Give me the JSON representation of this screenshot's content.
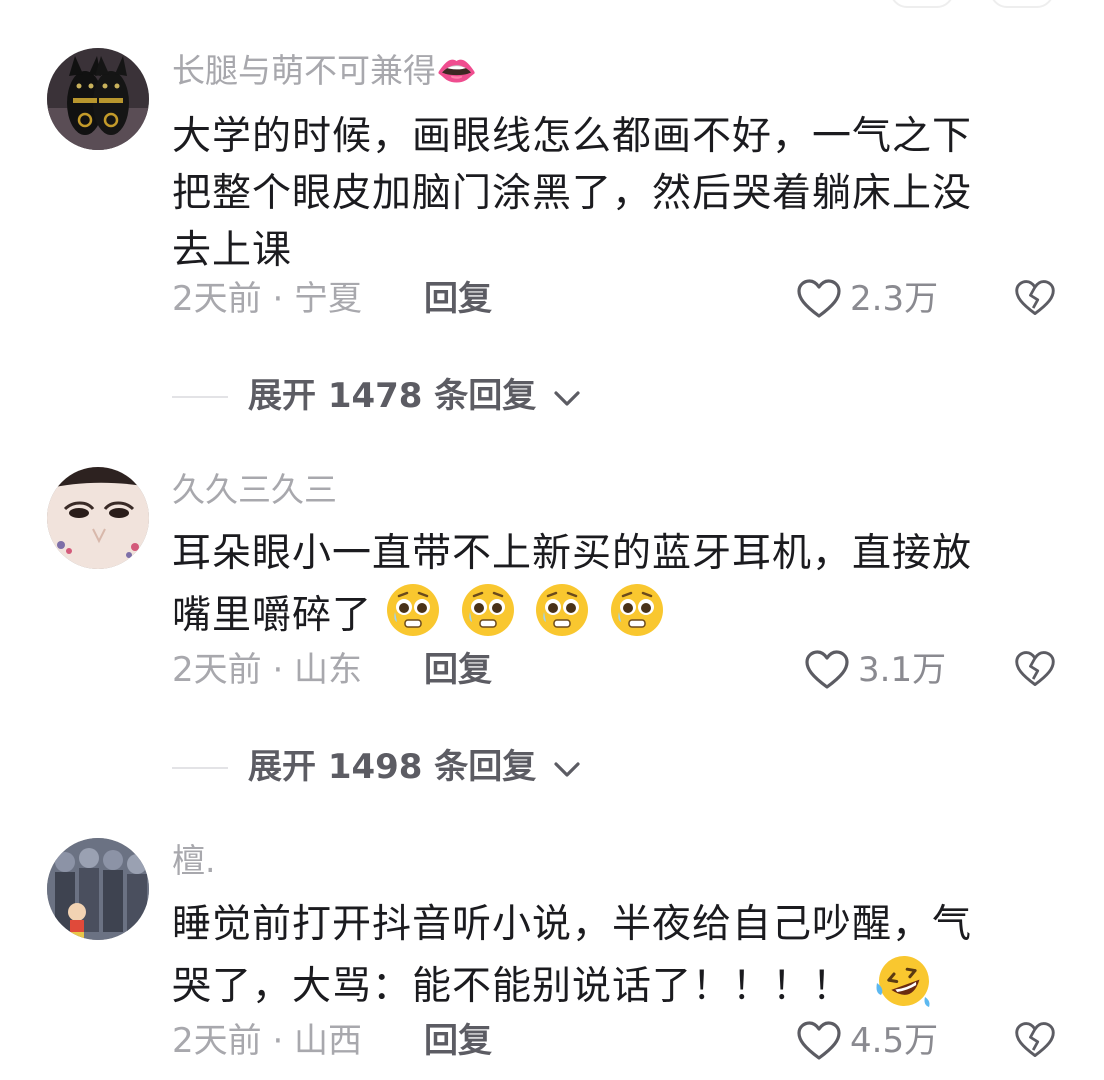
{
  "comments": [
    {
      "username": "长腿与萌不可兼得👄",
      "lines": [
        "大学的时候，画眼线怎么都画不好，一气之下",
        "把整个眼皮加脑门涂黑了，然后哭着躺床上没",
        "去上课"
      ],
      "meta": "2天前 · 宁夏",
      "reply_label": "回复",
      "likes": "2.3万",
      "avatar_icon": "black-cat-avatar"
    },
    {
      "username": "久久三久三",
      "lines": [
        "耳朵眼小一直带不上新买的蓝牙耳机，直接放",
        "嘴里嚼碎了"
      ],
      "emojis_after": [
        "pleading-face",
        "pleading-face",
        "pleading-face",
        "pleading-face"
      ],
      "meta": "2天前 · 山东",
      "reply_label": "回复",
      "likes": "3.1万",
      "avatar_icon": "face-closeup-avatar"
    },
    {
      "username": "檀.",
      "lines": [
        "睡觉前打开抖音听小说，半夜给自己吵醒，气",
        "哭了，大骂：能不能别说话了！！！！"
      ],
      "emojis_after": [
        "rolling-laughing-face"
      ],
      "meta": "2天前 · 山西",
      "reply_label": "回复",
      "likes": "4.5万",
      "avatar_icon": "cartoon-crowd-avatar"
    }
  ],
  "expand_rows": [
    {
      "label": "展开 1478 条回复"
    },
    {
      "label": "展开 1498 条回复"
    }
  ],
  "colors": {
    "username": "#a8a8ad",
    "text": "#1b1b1f",
    "meta": "#a8a8ad",
    "action": "#5c5c63"
  }
}
